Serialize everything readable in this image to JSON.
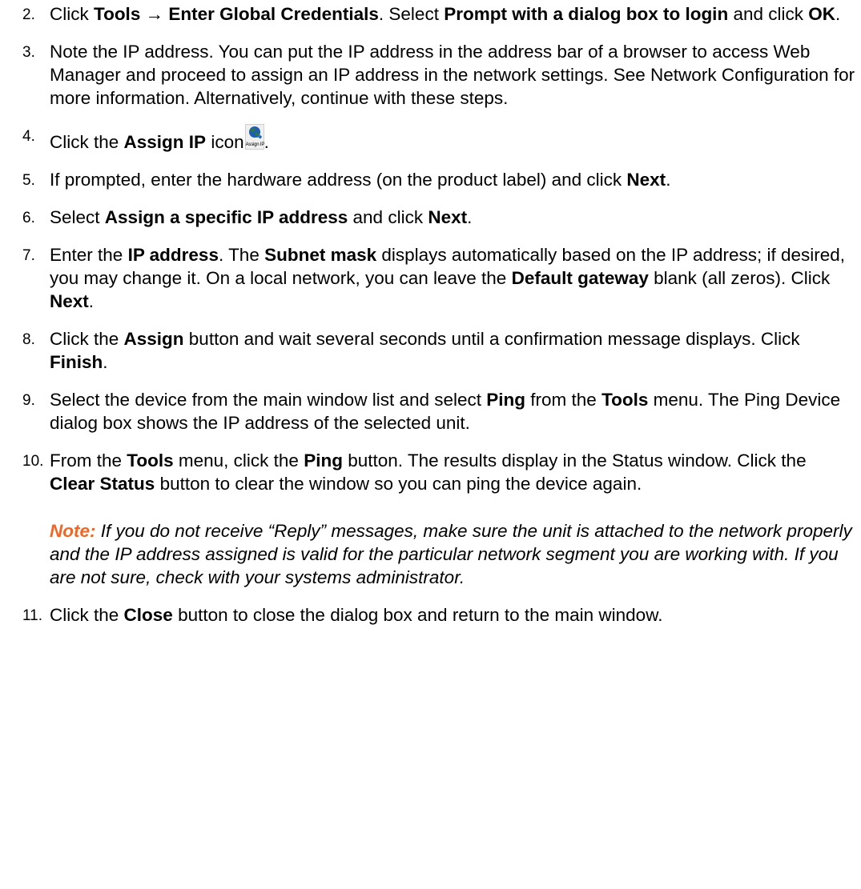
{
  "steps": [
    {
      "num": "2.",
      "parts": [
        {
          "t": "Click "
        },
        {
          "t": "Tools",
          "b": true
        },
        {
          "t": " → ",
          "b": true
        },
        {
          "t": "Enter Global Credentials",
          "b": true
        },
        {
          "t": ". Select "
        },
        {
          "t": "Prompt with a dialog box to login",
          "b": true
        },
        {
          "t": " and click "
        },
        {
          "t": "OK",
          "b": true
        },
        {
          "t": "."
        }
      ]
    },
    {
      "num": "3.",
      "parts": [
        {
          "t": "Note the IP address. You can put the IP address in the address bar of a browser to access Web Manager and proceed to assign an IP address in the network settings. See Network Configuration for more information. Alternatively, continue with these steps."
        }
      ]
    },
    {
      "num": "4.",
      "parts": [
        {
          "t": "Click the "
        },
        {
          "t": "Assign IP",
          "b": true
        },
        {
          "t": " icon"
        },
        {
          "icon": true
        },
        {
          "t": "."
        }
      ]
    },
    {
      "num": "5.",
      "parts": [
        {
          "t": "If prompted, enter the hardware address (on the product label) and click "
        },
        {
          "t": "Next",
          "b": true
        },
        {
          "t": "."
        }
      ]
    },
    {
      "num": "6.",
      "parts": [
        {
          "t": "Select "
        },
        {
          "t": "Assign a specific IP address",
          "b": true
        },
        {
          "t": " and click "
        },
        {
          "t": "Next",
          "b": true
        },
        {
          "t": "."
        }
      ]
    },
    {
      "num": "7.",
      "parts": [
        {
          "t": "Enter the "
        },
        {
          "t": "IP address",
          "b": true
        },
        {
          "t": ". The "
        },
        {
          "t": "Subnet mask",
          "b": true
        },
        {
          "t": " displays automatically based on the IP address; if desired, you may change it. On a local network, you can leave the "
        },
        {
          "t": "Default gateway",
          "b": true
        },
        {
          "t": " blank (all zeros). Click "
        },
        {
          "t": "Next",
          "b": true
        },
        {
          "t": "."
        }
      ]
    },
    {
      "num": "8.",
      "parts": [
        {
          "t": "Click the "
        },
        {
          "t": "Assign",
          "b": true
        },
        {
          "t": " button and wait several seconds until a confirmation message displays. Click "
        },
        {
          "t": "Finish",
          "b": true
        },
        {
          "t": "."
        }
      ]
    },
    {
      "num": "9.",
      "parts": [
        {
          "t": "Select the device from the main window list and select "
        },
        {
          "t": "Ping",
          "b": true
        },
        {
          "t": " from the "
        },
        {
          "t": "Tools",
          "b": true
        },
        {
          "t": " menu. The Ping Device dialog box shows the IP address of the selected unit."
        }
      ]
    },
    {
      "num": "10.",
      "parts": [
        {
          "t": "From the "
        },
        {
          "t": "Tools",
          "b": true
        },
        {
          "t": " menu, click the "
        },
        {
          "t": "Ping",
          "b": true
        },
        {
          "t": " button. The results display in the Status window. Click the "
        },
        {
          "t": "Clear Status",
          "b": true
        },
        {
          "t": " button to clear the window so you can ping the device again."
        }
      ],
      "note": {
        "label": "Note:",
        "text": " If you do not receive “Reply” messages, make sure the unit is attached to the network properly and the IP address assigned is valid for the particular network segment you are working with. If you are not sure, check with your systems administrator."
      }
    },
    {
      "num": "11.",
      "parts": [
        {
          "t": "Click the "
        },
        {
          "t": "Close",
          "b": true
        },
        {
          "t": " button to close the dialog box and return to the main window."
        }
      ]
    }
  ],
  "assign_icon": {
    "caption": "Assign IP",
    "icon": "globe-assign-icon",
    "colors": {
      "globe": "#2e7d32",
      "ocean": "#1e5fb4",
      "arrow": "#1565c0"
    }
  },
  "note_color": "#f26522"
}
